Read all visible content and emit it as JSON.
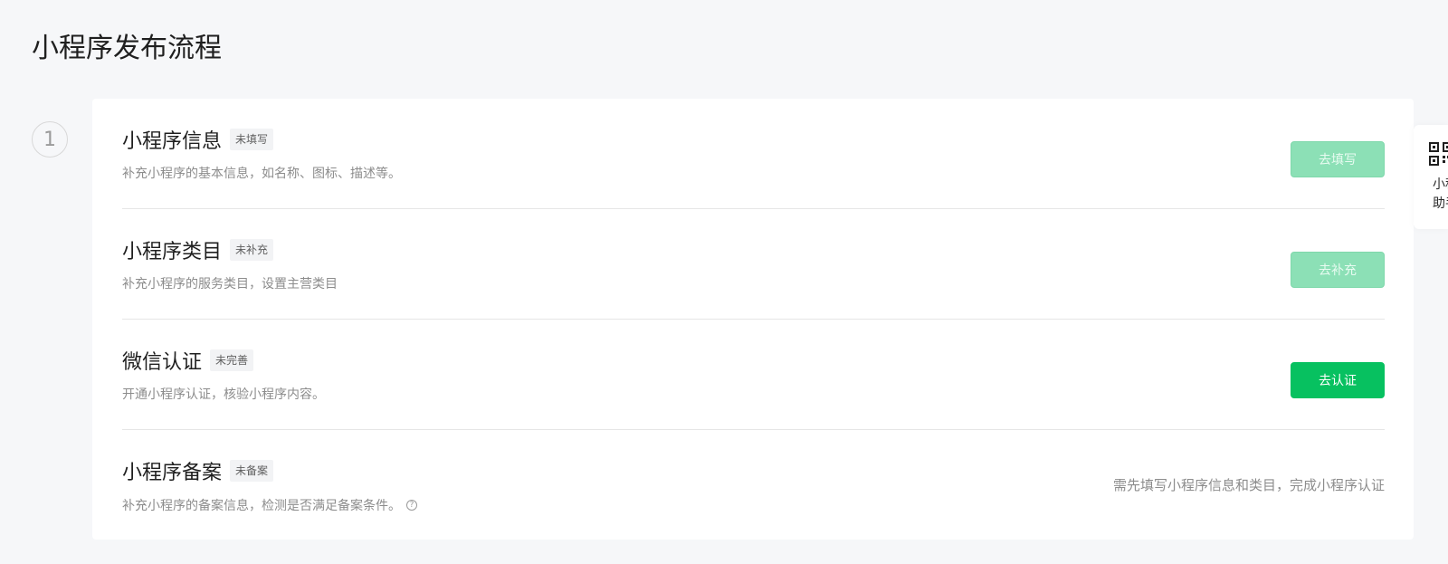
{
  "page": {
    "title": "小程序发布流程"
  },
  "steps": {
    "current_number": "1"
  },
  "items": [
    {
      "title": "小程序信息",
      "badge": "未填写",
      "description": "补充小程序的基本信息，如名称、图标、描述等。",
      "action_label": "去填写"
    },
    {
      "title": "小程序类目",
      "badge": "未补充",
      "description": "补充小程序的服务类目，设置主营类目",
      "action_label": "去补充"
    },
    {
      "title": "微信认证",
      "badge": "未完善",
      "description": "开通小程序认证，核验小程序内容。",
      "action_label": "去认证"
    },
    {
      "title": "小程序备案",
      "badge": "未备案",
      "description": "补充小程序的备案信息，检测是否满足备案条件。",
      "note": "需先填写小程序信息和类目，完成小程序认证"
    }
  ],
  "assistant": {
    "label": "小程\n助手",
    "icon": "qr-code-icon"
  },
  "colors": {
    "primary": "#07c160",
    "disabled_button": "#8ce0b6",
    "page_background": "#f6f7f9"
  }
}
